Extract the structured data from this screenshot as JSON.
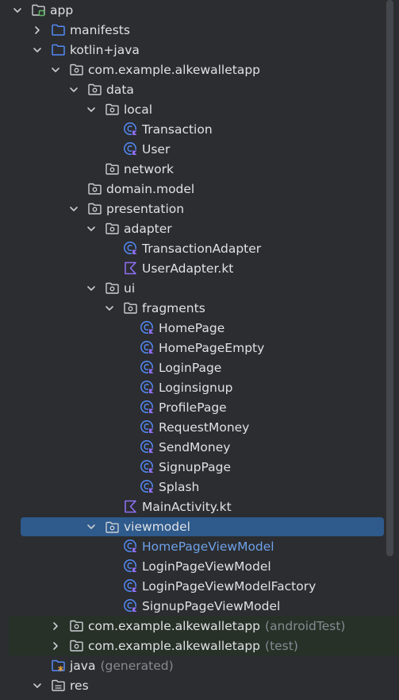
{
  "tree": {
    "items": [
      {
        "label": "app",
        "icon": "module-folder-icon"
      },
      {
        "label": "manifests",
        "icon": "folder-icon"
      },
      {
        "label": "kotlin+java",
        "icon": "source-folder-icon"
      },
      {
        "label": "com.example.alkewalletapp",
        "icon": "package-icon"
      },
      {
        "label": "data",
        "icon": "package-icon"
      },
      {
        "label": "local",
        "icon": "package-icon"
      },
      {
        "label": "Transaction",
        "icon": "kotlin-class-icon"
      },
      {
        "label": "User",
        "icon": "kotlin-class-icon"
      },
      {
        "label": "network",
        "icon": "package-icon"
      },
      {
        "label": "domain.model",
        "icon": "package-icon"
      },
      {
        "label": "presentation",
        "icon": "package-icon"
      },
      {
        "label": "adapter",
        "icon": "package-icon"
      },
      {
        "label": "TransactionAdapter",
        "icon": "kotlin-class-icon"
      },
      {
        "label": "UserAdapter.kt",
        "icon": "kotlin-file-icon"
      },
      {
        "label": "ui",
        "icon": "package-icon"
      },
      {
        "label": "fragments",
        "icon": "package-icon"
      },
      {
        "label": "HomePage",
        "icon": "kotlin-class-icon"
      },
      {
        "label": "HomePageEmpty",
        "icon": "kotlin-class-icon"
      },
      {
        "label": "LoginPage",
        "icon": "kotlin-class-icon"
      },
      {
        "label": "Loginsignup",
        "icon": "kotlin-class-icon"
      },
      {
        "label": "ProfilePage",
        "icon": "kotlin-class-icon"
      },
      {
        "label": "RequestMoney",
        "icon": "kotlin-class-icon"
      },
      {
        "label": "SendMoney",
        "icon": "kotlin-class-icon"
      },
      {
        "label": "SignupPage",
        "icon": "kotlin-class-icon"
      },
      {
        "label": "Splash",
        "icon": "kotlin-class-icon"
      },
      {
        "label": "MainActivity.kt",
        "icon": "kotlin-file-icon"
      },
      {
        "label": "viewmodel",
        "icon": "package-icon"
      },
      {
        "label": "HomePageViewModel",
        "icon": "kotlin-class-icon"
      },
      {
        "label": "LoginPageViewModel",
        "icon": "kotlin-class-icon"
      },
      {
        "label": "LoginPageViewModelFactory",
        "icon": "kotlin-class-icon"
      },
      {
        "label": "SignupPageViewModel",
        "icon": "kotlin-class-icon"
      },
      {
        "label": "com.example.alkewalletapp",
        "suffix": "(androidTest)",
        "icon": "package-icon"
      },
      {
        "label": "com.example.alkewalletapp",
        "suffix": "(test)",
        "icon": "package-icon"
      },
      {
        "label": "java",
        "suffix": "(generated)",
        "icon": "generated-folder-icon"
      },
      {
        "label": "res",
        "icon": "resources-folder-icon"
      }
    ]
  },
  "colors": {
    "background": "#2b2d30",
    "selection": "#2e5a8c",
    "test_rows": "#283128",
    "text": "#dfe1e5",
    "link_text": "#6ea0e8",
    "muted_text": "#868a91",
    "kotlin_icon": "#8d6ff2",
    "folder_icon": "#548af7"
  }
}
